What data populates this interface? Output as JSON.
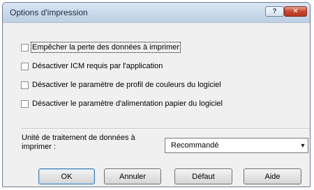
{
  "window": {
    "title": "Options d'impression",
    "help_label": "?",
    "close_label": "✕"
  },
  "options": [
    {
      "label": "Empêcher la perte des données à imprimer",
      "checked": false,
      "focused": true
    },
    {
      "label": "Désactiver ICM requis par l'application",
      "checked": false
    },
    {
      "label": "Désactiver le paramètre de profil de couleurs du logiciel",
      "checked": false
    },
    {
      "label": "Désactiver le paramètre d'alimentation papier du logiciel",
      "checked": false
    }
  ],
  "data_unit": {
    "label": "Unité de traitement de données à imprimer :",
    "value": "Recommandé"
  },
  "buttons": {
    "ok": "OK",
    "cancel": "Annuler",
    "default": "Défaut",
    "help": "Aide"
  },
  "colors": {
    "titlebar": "#c9d8ea",
    "close_button": "#c9452d",
    "dialog_background": "#f0f0f0"
  }
}
